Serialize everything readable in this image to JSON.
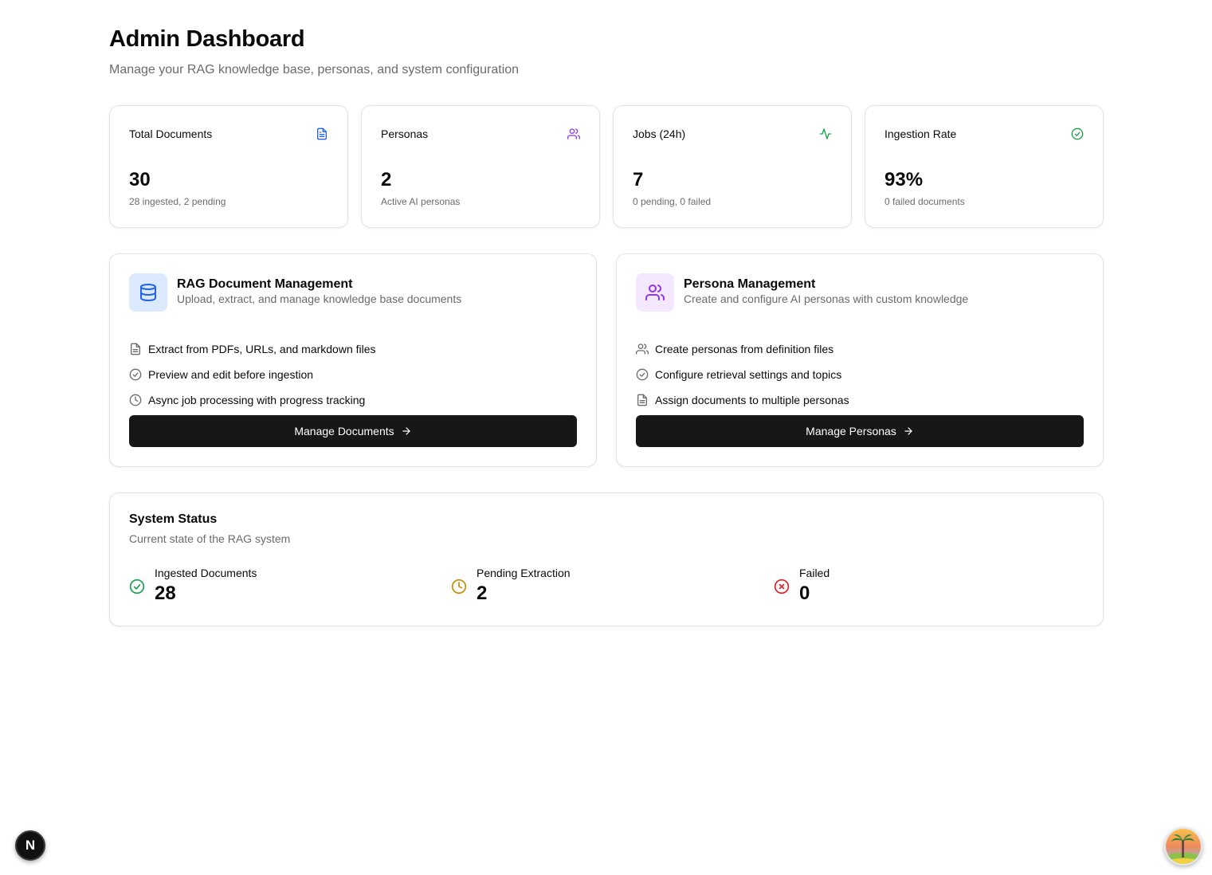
{
  "header": {
    "title": "Admin Dashboard",
    "subtitle": "Manage your RAG knowledge base, personas, and system configuration"
  },
  "stats": [
    {
      "label": "Total Documents",
      "value": "30",
      "sub": "28 ingested, 2 pending",
      "icon": "file-text-icon",
      "color": "#2563eb"
    },
    {
      "label": "Personas",
      "value": "2",
      "sub": "Active AI personas",
      "icon": "users-icon",
      "color": "#9333ea"
    },
    {
      "label": "Jobs (24h)",
      "value": "7",
      "sub": "0 pending, 0 failed",
      "icon": "activity-icon",
      "color": "#16a34a"
    },
    {
      "label": "Ingestion Rate",
      "value": "93%",
      "sub": "0 failed documents",
      "icon": "check-circle-icon",
      "color": "#16a34a"
    }
  ],
  "features": [
    {
      "title": "RAG Document Management",
      "description": "Upload, extract, and manage knowledge base documents",
      "icon": "database-icon",
      "accent": "#2563eb",
      "accent_bg": "#dbeafe",
      "items": [
        {
          "icon": "file-text-icon",
          "text": "Extract from PDFs, URLs, and markdown files"
        },
        {
          "icon": "check-circle-icon",
          "text": "Preview and edit before ingestion"
        },
        {
          "icon": "clock-icon",
          "text": "Async job processing with progress tracking"
        }
      ],
      "button": "Manage Documents"
    },
    {
      "title": "Persona Management",
      "description": "Create and configure AI personas with custom knowledge",
      "icon": "users-icon",
      "accent": "#9333ea",
      "accent_bg": "#f3e8ff",
      "items": [
        {
          "icon": "users-icon",
          "text": "Create personas from definition files"
        },
        {
          "icon": "check-circle-icon",
          "text": "Configure retrieval settings and topics"
        },
        {
          "icon": "file-text-icon",
          "text": "Assign documents to multiple personas"
        }
      ],
      "button": "Manage Personas"
    }
  ],
  "system_status": {
    "title": "System Status",
    "description": "Current state of the RAG system",
    "items": [
      {
        "label": "Ingested Documents",
        "value": "28",
        "icon": "check-circle-icon",
        "color": "#16a34a"
      },
      {
        "label": "Pending Extraction",
        "value": "2",
        "icon": "clock-icon",
        "color": "#ca8a04"
      },
      {
        "label": "Failed",
        "value": "0",
        "icon": "x-circle-icon",
        "color": "#dc2626"
      }
    ]
  },
  "overlays": {
    "dev_badge_letter": "N"
  }
}
